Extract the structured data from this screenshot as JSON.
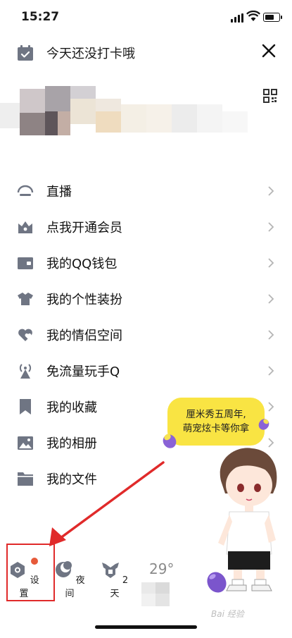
{
  "status_bar": {
    "time": "15:27"
  },
  "header": {
    "checkin_text": "今天还没打卡哦"
  },
  "menu": [
    {
      "label": "直播",
      "icon": "live-icon"
    },
    {
      "label": "点我开通会员",
      "icon": "vip-crown-icon"
    },
    {
      "label": "我的QQ钱包",
      "icon": "wallet-icon"
    },
    {
      "label": "我的个性装扮",
      "icon": "shirt-icon"
    },
    {
      "label": "我的情侣空间",
      "icon": "couple-hearts-icon"
    },
    {
      "label": "免流量玩手Q",
      "icon": "antenna-icon"
    },
    {
      "label": "我的收藏",
      "icon": "bookmark-icon"
    },
    {
      "label": "我的相册",
      "icon": "photo-album-icon"
    },
    {
      "label": "我的文件",
      "icon": "folder-icon"
    }
  ],
  "promo": {
    "line1": "厘米秀五周年,",
    "line2": "萌宠炫卡等你拿"
  },
  "toolbar": {
    "settings": "设置",
    "night": "夜间",
    "days": "2天",
    "temperature": "29°"
  },
  "watermark": "Bai 经验"
}
